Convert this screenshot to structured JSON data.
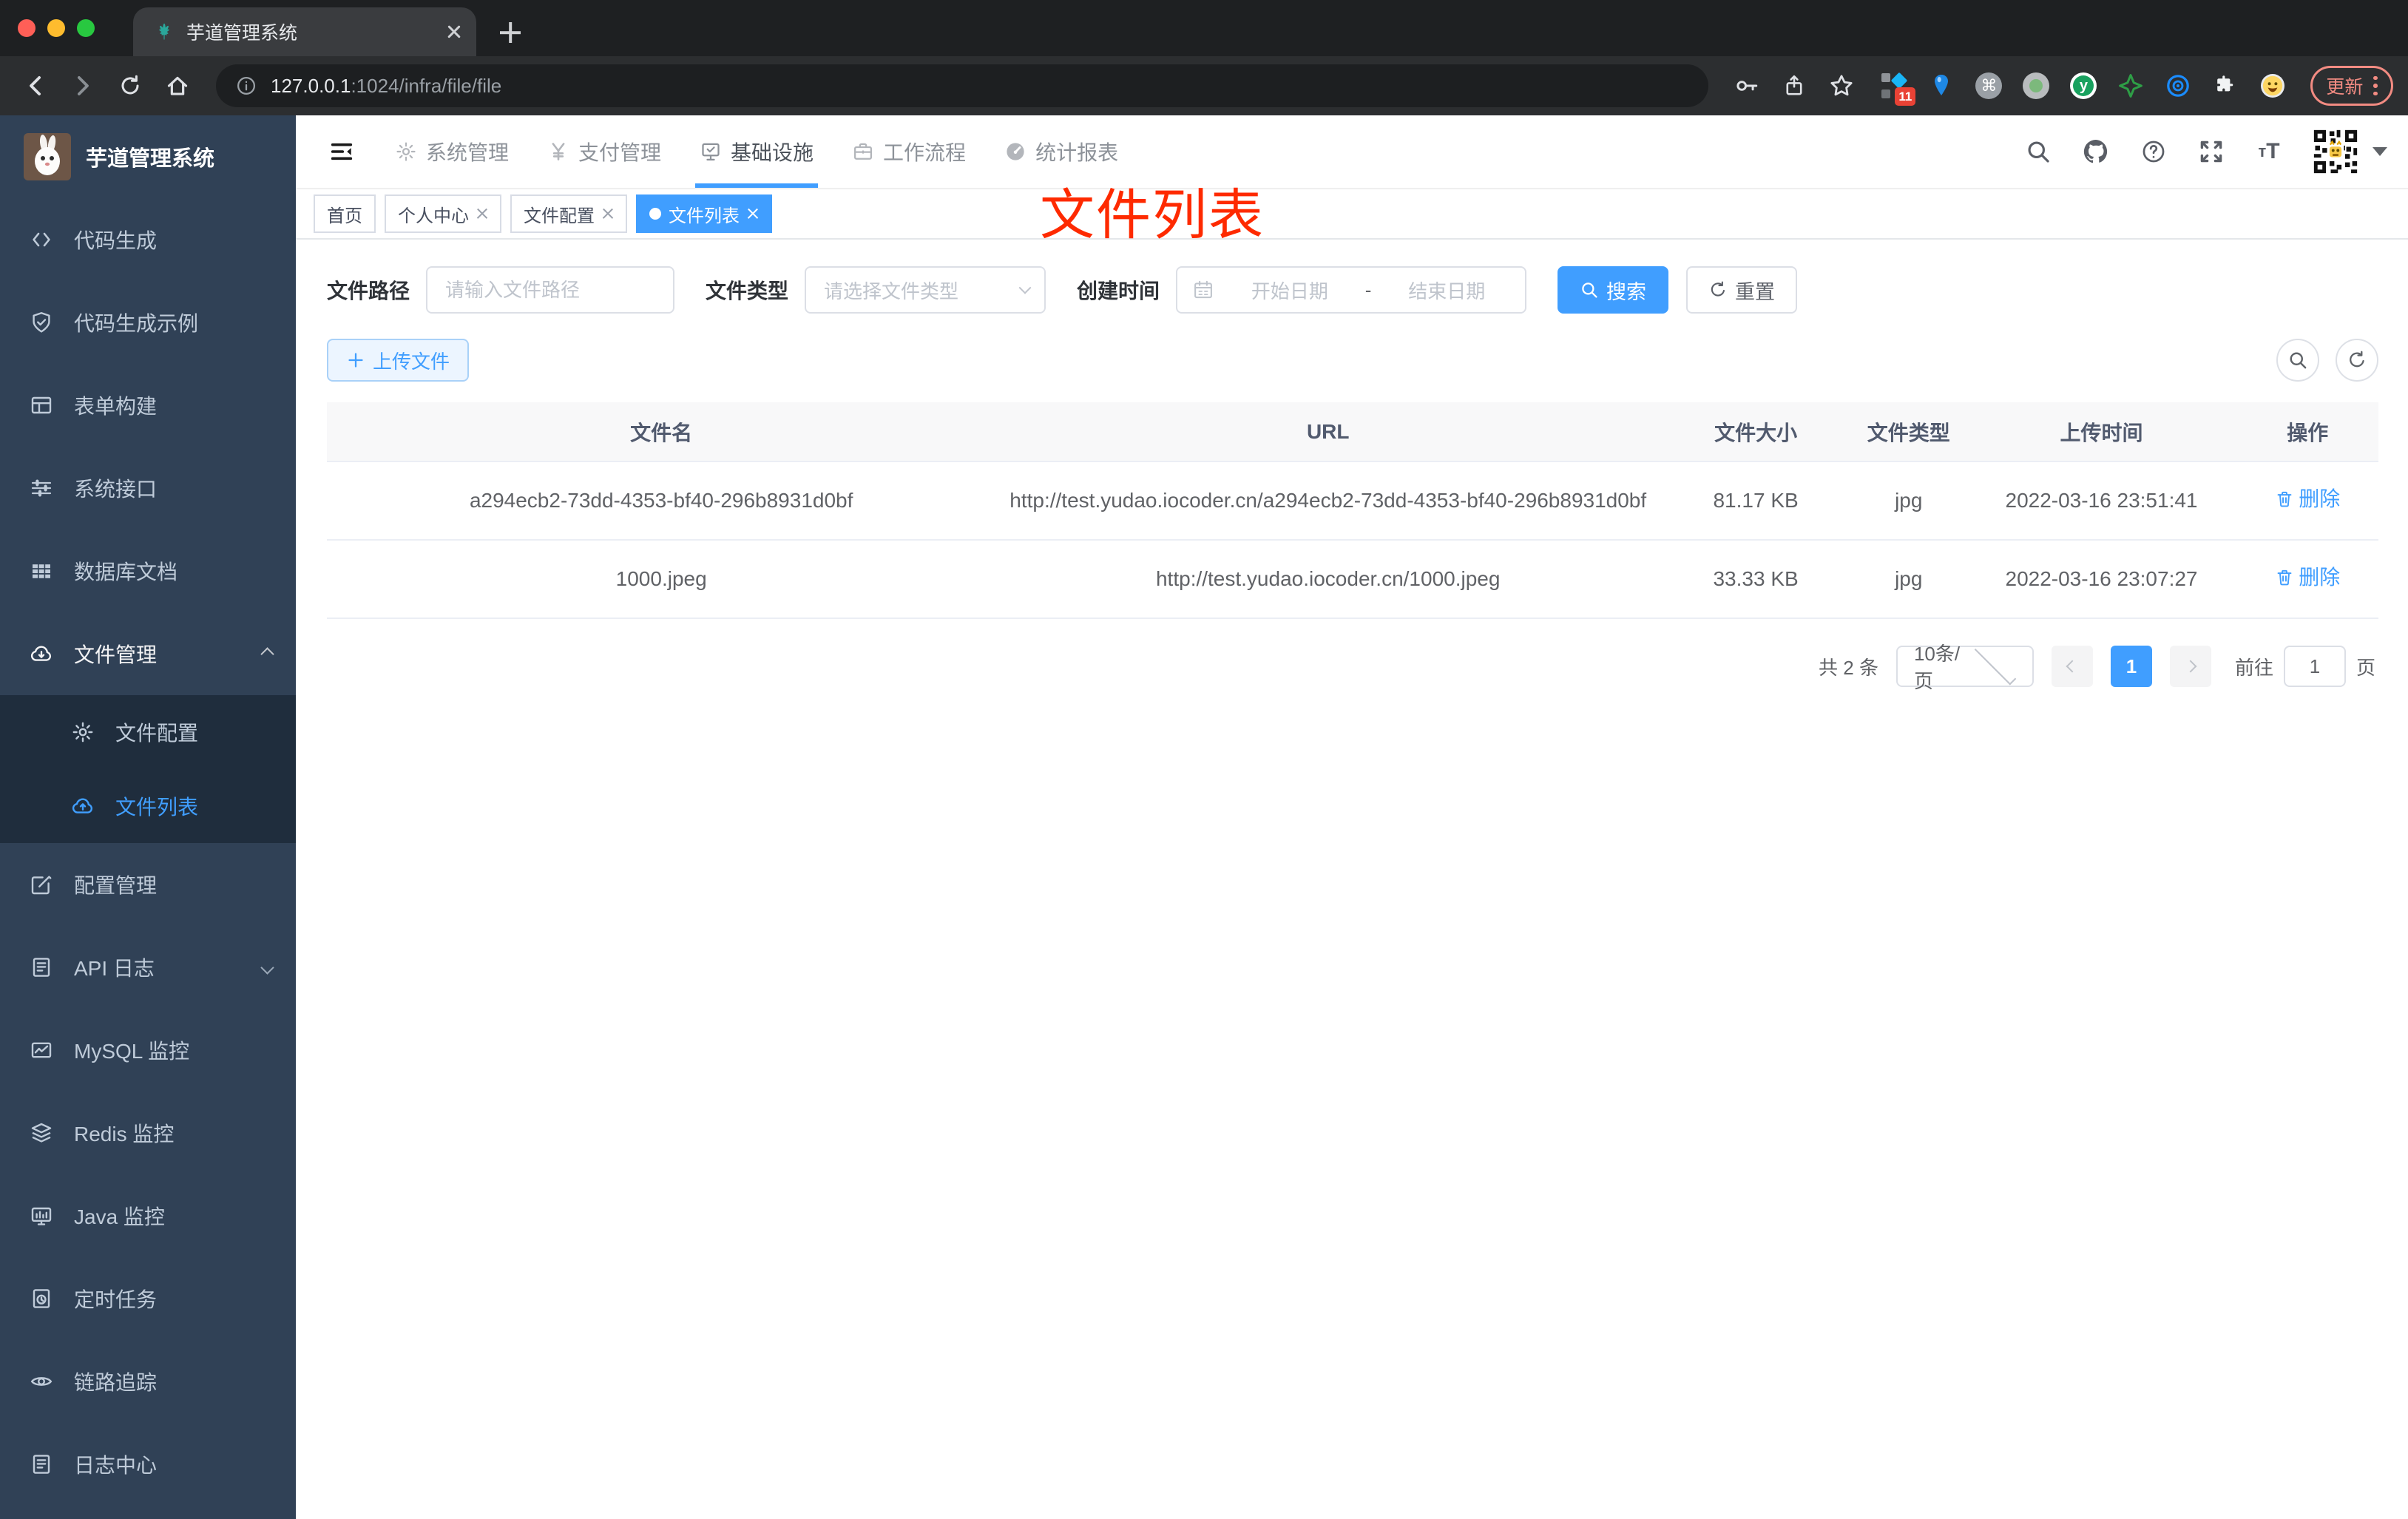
{
  "browser": {
    "tab_title": "芋道管理系统",
    "url_host": "127.0.0.1",
    "url_rest": ":1024/infra/file/file",
    "update_label": "更新",
    "extension_badge": "11",
    "traffic_colors": {
      "close": "#ff5f57",
      "min": "#febc2e",
      "max": "#28c840"
    }
  },
  "app_title": "芋道管理系统",
  "sidebar": {
    "items": [
      {
        "label": "代码生成",
        "icon": "code-icon"
      },
      {
        "label": "代码生成示例",
        "icon": "shield-check-icon"
      },
      {
        "label": "表单构建",
        "icon": "form-icon"
      },
      {
        "label": "系统接口",
        "icon": "sliders-icon"
      },
      {
        "label": "数据库文档",
        "icon": "database-grid-icon"
      },
      {
        "label": "文件管理",
        "icon": "cloud-download-icon",
        "expanded": true
      },
      {
        "label": "配置管理",
        "icon": "edit-square-icon"
      },
      {
        "label": "API 日志",
        "icon": "api-log-icon",
        "has_children": true
      },
      {
        "label": "MySQL 监控",
        "icon": "chart-monitor-icon"
      },
      {
        "label": "Redis 监控",
        "icon": "layers-icon"
      },
      {
        "label": "Java 监控",
        "icon": "java-monitor-icon"
      },
      {
        "label": "定时任务",
        "icon": "timer-doc-icon"
      },
      {
        "label": "链路追踪",
        "icon": "eye-icon"
      },
      {
        "label": "日志中心",
        "icon": "log-center-icon"
      }
    ],
    "file_submenu": [
      {
        "label": "文件配置",
        "icon": "gear-icon",
        "active": false
      },
      {
        "label": "文件列表",
        "icon": "cloud-upload-icon",
        "active": true
      }
    ]
  },
  "topnav": {
    "items": [
      {
        "label": "系统管理",
        "icon": "gear-icon"
      },
      {
        "label": "支付管理",
        "icon": "yen-icon"
      },
      {
        "label": "基础设施",
        "icon": "infra-monitor-icon",
        "active": true
      },
      {
        "label": "工作流程",
        "icon": "briefcase-icon"
      },
      {
        "label": "统计报表",
        "icon": "gauge-icon"
      }
    ]
  },
  "tags": {
    "items": [
      {
        "label": "首页",
        "closable": false,
        "active": false
      },
      {
        "label": "个人中心",
        "closable": true,
        "active": false
      },
      {
        "label": "文件配置",
        "closable": true,
        "active": false
      },
      {
        "label": "文件列表",
        "closable": true,
        "active": true
      }
    ]
  },
  "annotation": {
    "text": "文件列表",
    "color": "#fe2a00"
  },
  "filters": {
    "path_label": "文件路径",
    "path_placeholder": "请输入文件路径",
    "type_label": "文件类型",
    "type_placeholder": "请选择文件类型",
    "date_label": "创建时间",
    "date_start_placeholder": "开始日期",
    "date_separator": "-",
    "date_end_placeholder": "结束日期",
    "search_label": "搜索",
    "reset_label": "重置"
  },
  "toolbar": {
    "upload_label": "上传文件"
  },
  "table": {
    "columns": [
      "文件名",
      "URL",
      "文件大小",
      "文件类型",
      "上传时间",
      "操作"
    ],
    "rows": [
      {
        "name": "a294ecb2-73dd-4353-bf40-296b8931d0bf",
        "url": "http://test.yudao.iocoder.cn/a294ecb2-73dd-4353-bf40-296b8931d0bf",
        "size": "81.17 KB",
        "type": "jpg",
        "time": "2022-03-16 23:51:41",
        "action": "删除"
      },
      {
        "name": "1000.jpeg",
        "url": "http://test.yudao.iocoder.cn/1000.jpeg",
        "size": "33.33 KB",
        "type": "jpg",
        "time": "2022-03-16 23:07:27",
        "action": "删除"
      }
    ]
  },
  "pagination": {
    "total": "共 2 条",
    "page_size": "10条/页",
    "current_page": "1",
    "goto_label": "前往",
    "goto_value": "1",
    "page_unit": "页"
  },
  "colors": {
    "accent": "#409eff",
    "sidebar_bg": "#304156",
    "submenu_bg": "#1f2d3d",
    "annotation_red": "#fe2a00"
  }
}
